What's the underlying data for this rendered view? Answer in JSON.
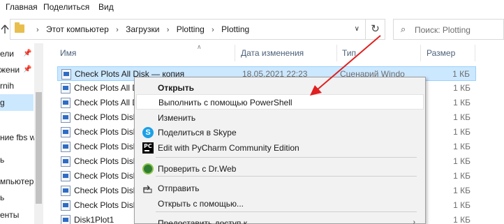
{
  "menu": {
    "items": [
      "Главная",
      "Поделиться",
      "Вид"
    ]
  },
  "address": {
    "crumbs": [
      "Этот компьютер",
      "Загрузки",
      "Plotting",
      "Plotting"
    ],
    "search_placeholder": "Поиск: Plotting"
  },
  "nav": {
    "items": [
      {
        "label": "ели",
        "pinned": true
      },
      {
        "label": "жени",
        "pinned": true
      },
      {
        "label": "rnih",
        "pinned": false
      },
      {
        "label": "g",
        "pinned": false
      },
      {
        "label": "ние fbs w",
        "pinned": false
      },
      {
        "label": "ь",
        "pinned": false
      },
      {
        "label": "мпьютер",
        "pinned": false
      },
      {
        "label": "ь",
        "pinned": false
      },
      {
        "label": "енты",
        "pinned": false
      }
    ]
  },
  "columns": {
    "name": "Имя",
    "date": "Дата изменения",
    "type": "Тип",
    "size": "Размер"
  },
  "files": [
    {
      "name": "Check Plots All Disk — копия",
      "date": "18.05.2021 22:23",
      "type": "Сценарий Windo",
      "size": "1 КБ",
      "selected": true
    },
    {
      "name": "Check Plots All D",
      "date": "",
      "type": "",
      "size": "1 КБ",
      "selected": false
    },
    {
      "name": "Check Plots All D",
      "date": "",
      "type": "",
      "size": "1 КБ",
      "selected": false
    },
    {
      "name": "Check Plots Disk",
      "date": "",
      "type": "",
      "size": "1 КБ",
      "selected": false
    },
    {
      "name": "Check Plots Disk",
      "date": "",
      "type": "",
      "size": "1 КБ",
      "selected": false
    },
    {
      "name": "Check Plots Disk",
      "date": "",
      "type": "",
      "size": "1 КБ",
      "selected": false
    },
    {
      "name": "Check Plots Disk",
      "date": "",
      "type": "",
      "size": "1 КБ",
      "selected": false
    },
    {
      "name": "Check Plots Disk",
      "date": "",
      "type": "",
      "size": "1 КБ",
      "selected": false
    },
    {
      "name": "Check Plots Disk",
      "date": "",
      "type": "",
      "size": "1 КБ",
      "selected": false
    },
    {
      "name": "Check Plots Disk",
      "date": "",
      "type": "",
      "size": "1 КБ",
      "selected": false
    },
    {
      "name": "Disk1Plot1",
      "date": "",
      "type": "",
      "size": "1 КБ",
      "selected": false
    }
  ],
  "context_menu": {
    "items": [
      {
        "label": "Открыть",
        "bold": true,
        "icon": "",
        "submenu": false,
        "highlight": false
      },
      {
        "label": "Выполнить с помощью PowerShell",
        "bold": false,
        "icon": "",
        "submenu": false,
        "highlight": true
      },
      {
        "label": "Изменить",
        "bold": false,
        "icon": "",
        "submenu": false,
        "highlight": false
      },
      {
        "label": "Поделиться в Skype",
        "bold": false,
        "icon": "skype-icon",
        "submenu": false,
        "highlight": false
      },
      {
        "label": "Edit with PyCharm Community Edition",
        "bold": false,
        "icon": "pycharm-icon",
        "submenu": false,
        "highlight": false
      },
      {
        "label": "Проверить с Dr.Web",
        "bold": false,
        "icon": "drweb-icon",
        "submenu": false,
        "highlight": false
      },
      {
        "label": "Отправить",
        "bold": false,
        "icon": "share-icon",
        "submenu": false,
        "highlight": false
      },
      {
        "label": "Открыть с помощью...",
        "bold": false,
        "icon": "",
        "submenu": false,
        "highlight": false
      },
      {
        "label": "Предоставить доступ к",
        "bold": false,
        "icon": "",
        "submenu": true,
        "highlight": false
      }
    ]
  },
  "colors": {
    "selection": "#cce8ff",
    "annotation_arrow": "#e02020"
  }
}
